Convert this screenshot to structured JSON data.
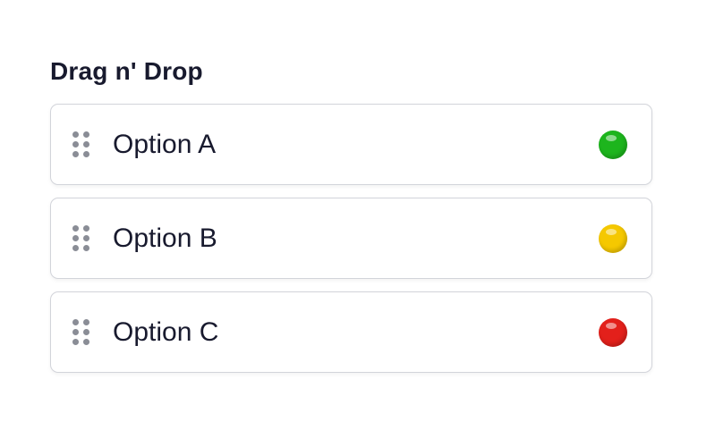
{
  "section": {
    "title": "Drag n' Drop"
  },
  "items": [
    {
      "label": "Option A",
      "status_color": "#1db51d",
      "handle_icon": "drag-handle-icon"
    },
    {
      "label": "Option B",
      "status_color": "#f5c800",
      "handle_icon": "drag-handle-icon"
    },
    {
      "label": "Option C",
      "status_color": "#e3201b",
      "handle_icon": "drag-handle-icon"
    }
  ]
}
